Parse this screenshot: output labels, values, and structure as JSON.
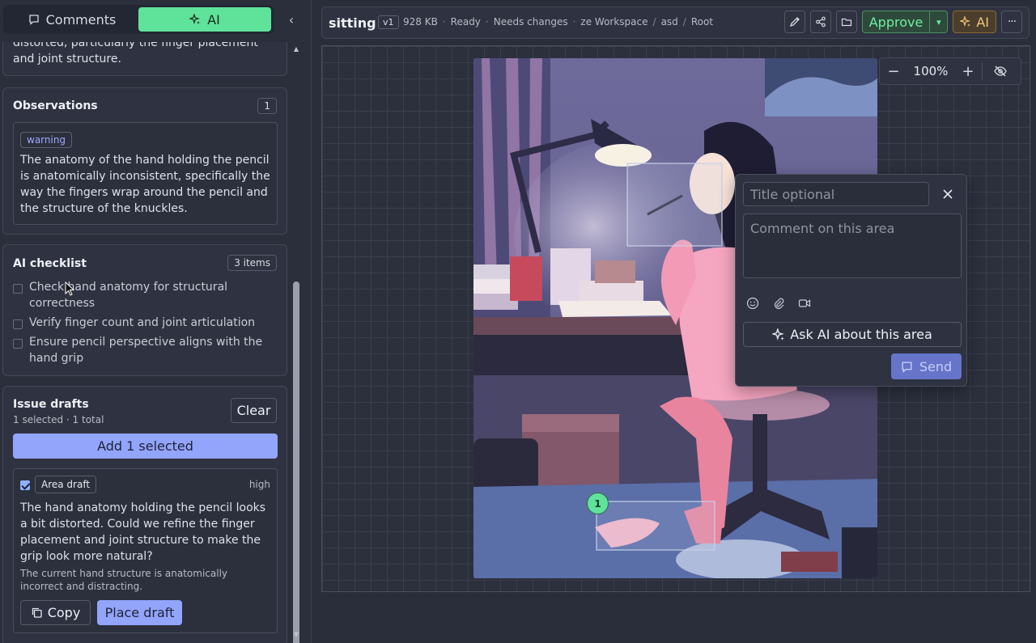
{
  "sidebar": {
    "tabs": [
      {
        "label": "Comments",
        "active": false
      },
      {
        "label": "AI",
        "active": true
      }
    ],
    "truncated_text": "distorted, particularly the finger placement and joint structure.",
    "observations": {
      "title": "Observations",
      "count": "1",
      "items": [
        {
          "tag": "warning",
          "text": "The anatomy of the hand holding the pencil is anatomically inconsistent, specifically the way the fingers wrap around the pencil and the structure of the knuckles."
        }
      ]
    },
    "checklist": {
      "title": "AI checklist",
      "count": "3 items",
      "items": [
        {
          "label": "Check hand anatomy for structural correctness",
          "checked": false
        },
        {
          "label": "Verify finger count and joint articulation",
          "checked": false
        },
        {
          "label": "Ensure pencil perspective aligns with the hand grip",
          "checked": false
        }
      ]
    },
    "drafts": {
      "title": "Issue drafts",
      "subtitle": "1 selected · 1 total",
      "clear_label": "Clear",
      "add_label": "Add 1 selected",
      "items": [
        {
          "selected": true,
          "type": "Area draft",
          "priority": "high",
          "text": "The hand anatomy holding the pencil looks a bit distorted. Could we refine the finger placement and joint structure to make the grip look more natural?",
          "reason": "The current hand structure is anatomically incorrect and distracting.",
          "copy_label": "Copy",
          "place_label": "Place draft"
        }
      ]
    }
  },
  "header": {
    "title": "sitting",
    "version": "v1",
    "size": "928 KB",
    "status": "Ready",
    "review": "Needs changes",
    "breadcrumb": [
      "ze Workspace",
      "asd",
      "Root"
    ],
    "approve_label": "Approve",
    "ai_label": "AI"
  },
  "canvas": {
    "zoom": "100%",
    "pin_number": "1"
  },
  "popup": {
    "title_placeholder": "Title optional",
    "comment_placeholder": "Comment on this area",
    "ask_ai_label": "Ask AI about this area",
    "send_label": "Send"
  },
  "colors": {
    "accent_green": "#5fe39a",
    "accent_blue": "#93a4fb",
    "ai_orange": "#f1c57a"
  }
}
